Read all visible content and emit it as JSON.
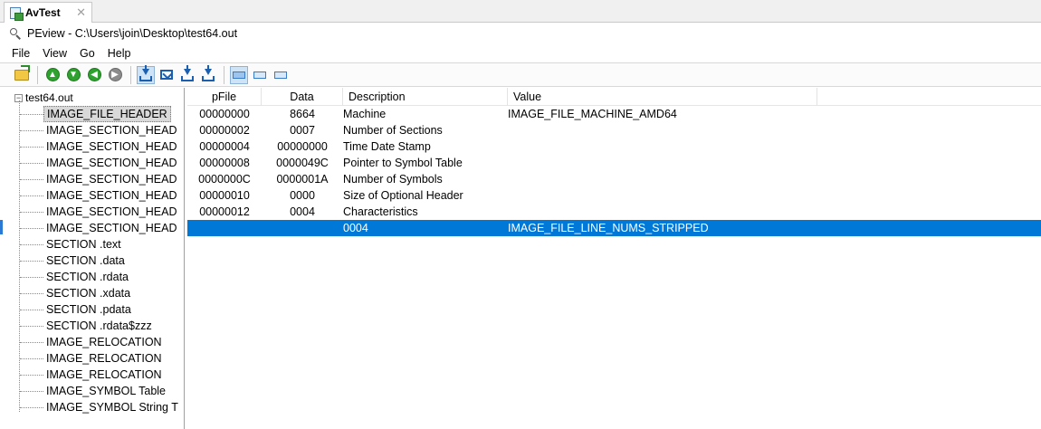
{
  "tab": {
    "label": "AvTest",
    "close_glyph": "✕"
  },
  "title": "PEview - C:\\Users\\join\\Desktop\\test64.out",
  "menu": [
    "File",
    "View",
    "Go",
    "Help"
  ],
  "toolbar_icons": [
    "open-file-icon",
    "back-icon",
    "forward-icon",
    "up-icon",
    "refresh-icon",
    "download-icon",
    "mail-icon",
    "download-prev-icon",
    "download-next-icon",
    "view-byte-icon",
    "view-word-icon",
    "view-dword-icon"
  ],
  "tree": {
    "root": "test64.out",
    "expander": "−",
    "items": [
      "IMAGE_FILE_HEADER",
      "IMAGE_SECTION_HEAD",
      "IMAGE_SECTION_HEAD",
      "IMAGE_SECTION_HEAD",
      "IMAGE_SECTION_HEAD",
      "IMAGE_SECTION_HEAD",
      "IMAGE_SECTION_HEAD",
      "IMAGE_SECTION_HEAD",
      "SECTION .text",
      "SECTION .data",
      "SECTION .rdata",
      "SECTION .xdata",
      "SECTION .pdata",
      "SECTION .rdata$zzz",
      "IMAGE_RELOCATION",
      "IMAGE_RELOCATION",
      "IMAGE_RELOCATION",
      "IMAGE_SYMBOL Table",
      "IMAGE_SYMBOL String T"
    ]
  },
  "table": {
    "columns": [
      "pFile",
      "Data",
      "Description",
      "Value"
    ],
    "rows": [
      {
        "pfile": "00000000",
        "data": "8664",
        "desc": "Machine",
        "value": "IMAGE_FILE_MACHINE_AMD64"
      },
      {
        "pfile": "00000002",
        "data": "0007",
        "desc": "Number of Sections",
        "value": ""
      },
      {
        "pfile": "00000004",
        "data": "00000000",
        "desc": "Time Date Stamp",
        "value": ""
      },
      {
        "pfile": "00000008",
        "data": "0000049C",
        "desc": "Pointer to Symbol Table",
        "value": ""
      },
      {
        "pfile": "0000000C",
        "data": "0000001A",
        "desc": "Number of Symbols",
        "value": ""
      },
      {
        "pfile": "00000010",
        "data": "0000",
        "desc": "Size of Optional Header",
        "value": ""
      },
      {
        "pfile": "00000012",
        "data": "0004",
        "desc": "Characteristics",
        "value": ""
      },
      {
        "pfile": "",
        "data": "",
        "desc": "0004",
        "value": "IMAGE_FILE_LINE_NUMS_STRIPPED"
      }
    ]
  },
  "colors": {
    "selection": "#0078d7",
    "tree_selection": "#d9d9d9"
  }
}
